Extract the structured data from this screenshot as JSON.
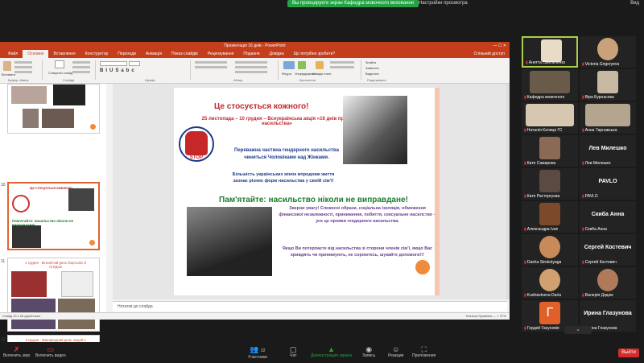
{
  "top_bar": {
    "share_status": "Вы проецируете экран Кафедра мовочного виховання",
    "view_options": "Настройки просмотра",
    "view": "Вид"
  },
  "powerpoint": {
    "title": "Презентація 16 днів - PowerPoint",
    "tabs": [
      "Файл",
      "Основне",
      "Вставлення",
      "Конструктор",
      "Переходи",
      "Анімація",
      "Показ слайдів",
      "Рецензування",
      "Подання",
      "Довідка",
      "Що потрібно зробити?"
    ],
    "active_tab": "Основне",
    "share": "Спільний доступ",
    "ribbon_groups": [
      "Буфер обміну",
      "Слайди",
      "Шрифт",
      "Абзац",
      "Креслення",
      "Редагування"
    ],
    "ribbon_buttons": {
      "paste": "Вставити",
      "new_slide": "Створити слайд",
      "shapes": "Фігури",
      "arrange": "Упорядкувати",
      "quick_styles": "Швидкі стилі",
      "find": "Знайти",
      "replace": "Замінити",
      "select": "Виділити"
    },
    "notes_placeholder": "Нотатки до слайда",
    "status_left": "Слайд 10 з 28   українська",
    "status_right": "Нотатки   Примітки   — + 97%",
    "thumbnails": [
      {
        "num": "",
        "caption": ""
      },
      {
        "num": "10",
        "caption": "Це стосується кожного!"
      },
      {
        "num": "11",
        "caption": "1 грудня - Всесвітній день боротьби зі СНІДом"
      },
      {
        "num": "12",
        "caption": "3 грудня - Міжнародний день людей з інвалідністю"
      }
    ],
    "slide": {
      "title": "Це стосується кожного!",
      "subtitle": "25 листопада – 10 грудня – Всеукраїнська акція «16 днів проти насильства»",
      "p1": "Переважна частина гендерного насильства чиниться Чоловіками над Жінками.",
      "p2": "Більшість українських жінок впродовж життя зазнає різних форм насильства у своїй сім'ї!",
      "big": "Пам'ятайте: насильство ніколи не виправдане!",
      "p3": "Зверни увагу! Словесні образи, соціальна ізоляція, обмеження фінансової незалежності, приниження, побиття, сексуальне насилство – усе це прояви гендерного насильства.",
      "p4": "Якщо Ви потерпаєте від насильства зі сторони членів сім'ї, якщо Вас кривдять чи принижують, не соромтесь, шукайте допомоги!!!",
      "stop_text": "STOP"
    }
  },
  "participants": [
    {
      "name": "Анетта Омельченко",
      "speaking": true
    },
    {
      "name": "Victoria Grigoryeva"
    },
    {
      "name": "Кафедра мовочного"
    },
    {
      "name": "Віра Бурнасова"
    },
    {
      "name": "Наталія Колиця ГС"
    },
    {
      "name": "Анна Тарнавська"
    },
    {
      "name": "Катя Самарова"
    },
    {
      "name": "Лев Милешко",
      "big": "Лев Милешко"
    },
    {
      "name": "Катя Расторгуєва"
    },
    {
      "name": "PAVLO",
      "big": "PAVLO"
    },
    {
      "name": "Александра Ivan"
    },
    {
      "name": "Скиба Анна",
      "big": "Скиба Анна"
    },
    {
      "name": "Dasha Strokotyaga"
    },
    {
      "name": "Сергей Костевич",
      "big": "Сергей Костевич"
    },
    {
      "name": "Kudriavtseva Daria"
    },
    {
      "name": "Валерія Дядюк"
    },
    {
      "name": "Гордей Ганусевія"
    },
    {
      "name": "Ирина Глазунова",
      "big": "Ирина Глазунова"
    }
  ],
  "bottom_bar": {
    "mute": "Включить звук",
    "video": "Включить видео",
    "participants": "Участники",
    "participants_count": "22",
    "chat": "Чат",
    "share": "Демонстрация экрана",
    "record": "Запись",
    "reactions": "Реакции",
    "apps": "Приложения",
    "exit": "Выйти"
  },
  "colors": {
    "ppt_red": "#c43e1c",
    "zoom_green": "#25a244",
    "speaker_border": "#a9d04a",
    "slide_red": "#c0282e",
    "exit_red": "#d42c2c"
  }
}
